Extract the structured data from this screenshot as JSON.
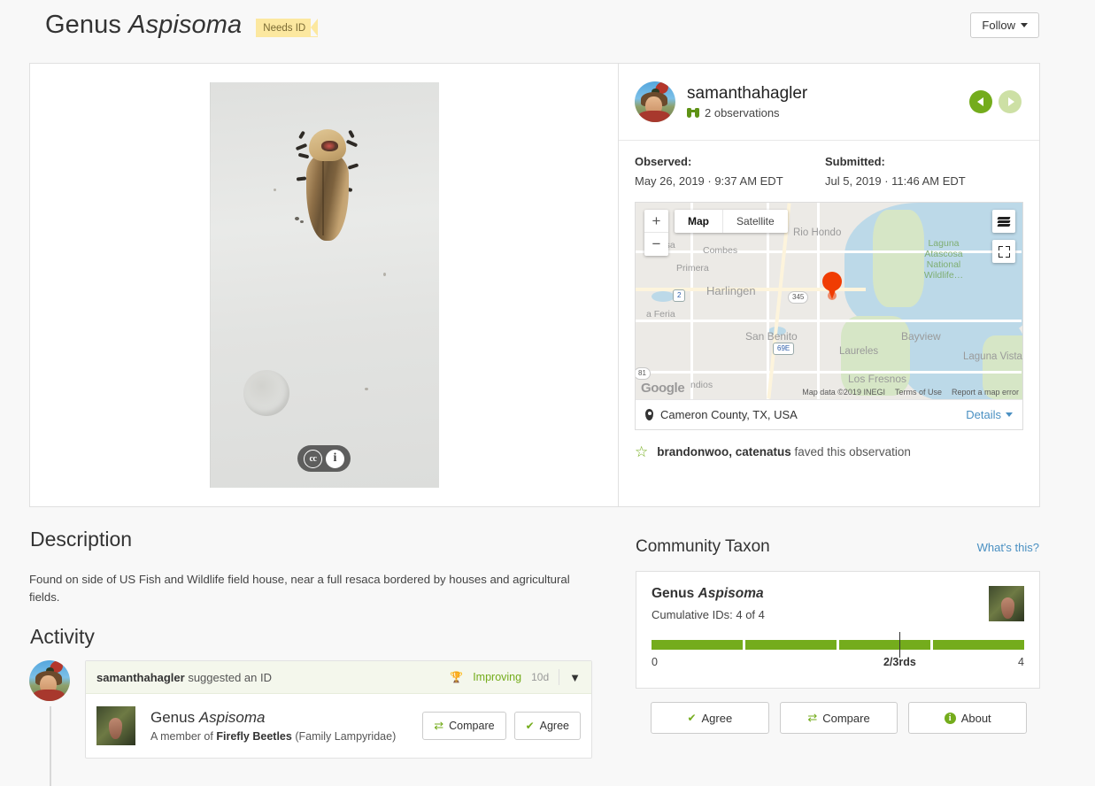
{
  "header": {
    "title_prefix": "Genus",
    "title_sci": "Aspisoma",
    "badge": "Needs ID",
    "follow_label": "Follow"
  },
  "photo": {
    "cc_icon": "creative-commons-icon",
    "info_icon": "info-icon"
  },
  "user": {
    "name": "samanthahagler",
    "observations": "2 observations",
    "prev_icon": "chevron-left-icon",
    "next_icon": "chevron-right-icon"
  },
  "dates": {
    "observed_label": "Observed:",
    "observed_value": "May 26, 2019 · 9:37 AM EDT",
    "submitted_label": "Submitted:",
    "submitted_value": "Jul 5, 2019 · 11:46 AM EDT"
  },
  "map": {
    "zoom_in": "+",
    "zoom_out": "−",
    "type_map": "Map",
    "type_satellite": "Satellite",
    "layers_icon": "layers-icon",
    "fullscreen_icon": "fullscreen-icon",
    "google_logo": "Google",
    "attribution": "Map data ©2019 INEGI",
    "terms": "Terms of Use",
    "report": "Report a map error",
    "labels": [
      "Combes",
      "Primera",
      "Harlingen",
      "Rio Hondo",
      "San Benito",
      "Laureles",
      "Bayview",
      "Los Fresnos",
      "Laguna Vista"
    ],
    "park_label": "Laguna Atascosa National Wildlife...",
    "shields": [
      "2",
      "345",
      "69E",
      "81"
    ],
    "location": "Cameron County, TX, USA",
    "details_label": "Details"
  },
  "faves": {
    "users": "brandonwoo, catenatus",
    "text": "faved this observation"
  },
  "description": {
    "heading": "Description",
    "body": "Found on side of US Fish and Wildlife field house, near a full resaca bordered by houses and agricultural fields."
  },
  "activity": {
    "heading": "Activity",
    "entry_user": "samanthahagler",
    "entry_action": "suggested an ID",
    "quality": "Improving",
    "time": "10d",
    "taxon_prefix": "Genus",
    "taxon_sci": "Aspisoma",
    "taxon_member_prefix": "A member of",
    "taxon_family_common": "Firefly Beetles",
    "taxon_family_sci": "(Family Lampyridae)",
    "compare_label": "Compare",
    "agree_label": "Agree"
  },
  "community_taxon": {
    "heading": "Community Taxon",
    "whats_this": "What's this?",
    "taxon_prefix": "Genus",
    "taxon_sci": "Aspisoma",
    "cumulative_ids": "Cumulative IDs: 4 of 4",
    "scale_min": "0",
    "scale_mid": "2/3rds",
    "scale_max": "4",
    "agree_label": "Agree",
    "compare_label": "Compare",
    "about_label": "About"
  },
  "colors": {
    "green": "#74ac1c",
    "link": "#4a90c2",
    "badge_bg": "#fce8a0",
    "marker": "#f03c02"
  }
}
